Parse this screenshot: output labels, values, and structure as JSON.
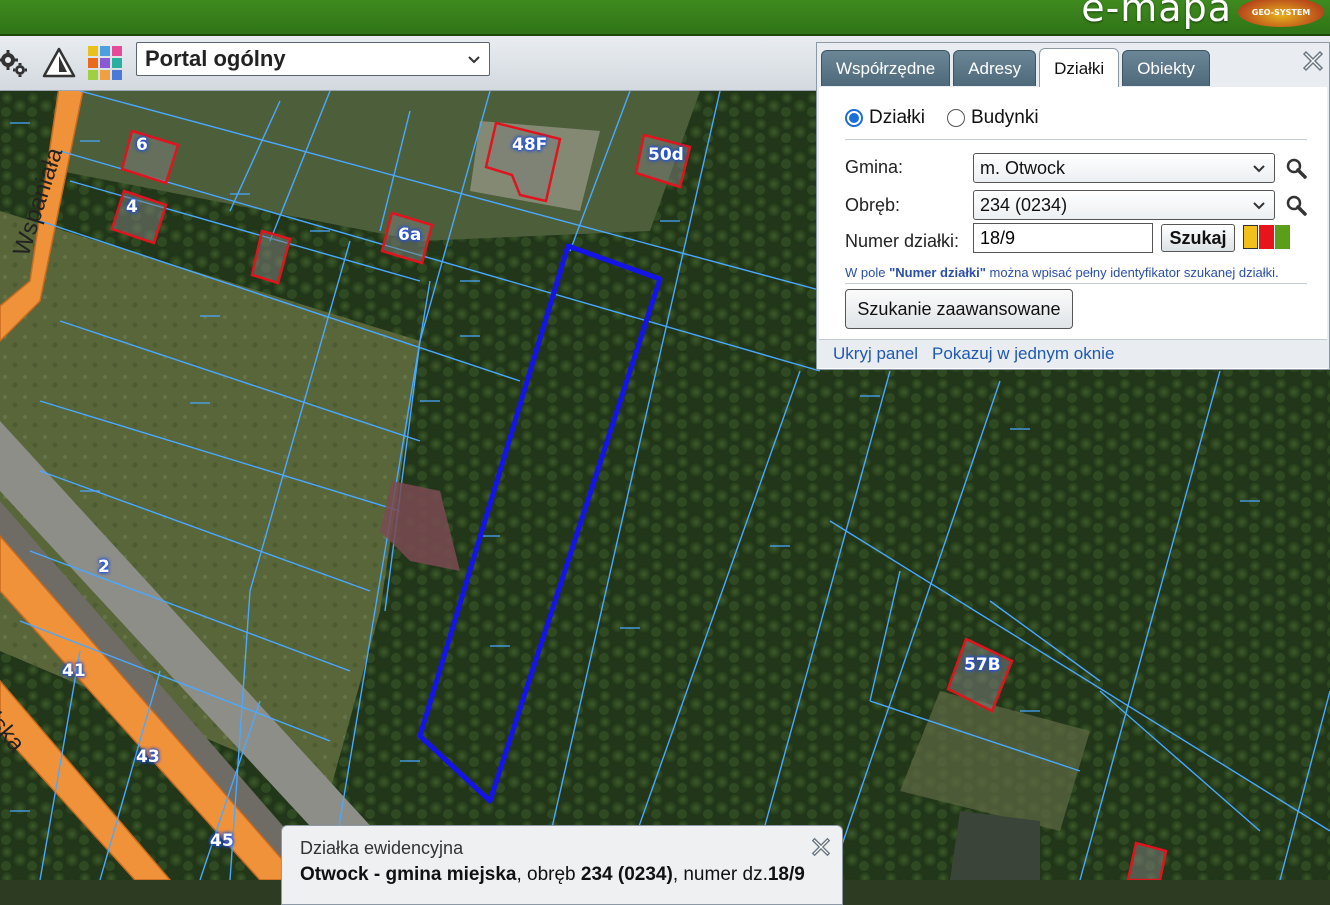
{
  "app": {
    "logo_text": "e-mapa",
    "logo_badge": "GEO-SYSTEM"
  },
  "toolbar": {
    "portal_select_value": "Portal ogólny",
    "icons": [
      "gears-icon",
      "warning-icon",
      "color-grid-icon"
    ]
  },
  "map": {
    "street_labels": [
      "Wspaniała",
      "elska"
    ],
    "address_labels": [
      "6",
      "4",
      "6a",
      "48F",
      "50d",
      "57B",
      "2",
      "41",
      "43",
      "45"
    ]
  },
  "panel": {
    "tabs": [
      {
        "label": "Współrzędne",
        "active": false
      },
      {
        "label": "Adresy",
        "active": false
      },
      {
        "label": "Działki",
        "active": true
      },
      {
        "label": "Obiekty",
        "active": false
      }
    ],
    "radio_dzialki": "Działki",
    "radio_budynki": "Budynki",
    "gmina_label": "Gmina:",
    "gmina_value": "m. Otwock",
    "obreb_label": "Obręb:",
    "obreb_value": "234 (0234)",
    "numer_label": "Numer działki:",
    "numer_value": "18/9",
    "search_button": "Szukaj",
    "color_boxes": [
      "#f2c01a",
      "#e8141b",
      "#5a9e1a"
    ],
    "hint_prefix": "W pole ",
    "hint_bold": "\"Numer działki\"",
    "hint_suffix": " można wpisać pełny identyfikator szukanej działki.",
    "advanced_button": "Szukanie zaawansowane",
    "footer_hide": "Ukryj panel",
    "footer_single": "Pokazuj w jednym oknie"
  },
  "info_box": {
    "title": "Działka ewidencyjna",
    "gmina": "Otwock - gmina miejska",
    "obreb_text": ", obręb ",
    "obreb": "234 (0234)",
    "numer_text": ", numer dz.",
    "numer": "18/9"
  },
  "colors": {
    "topbar": "#3f8a1f",
    "parcel_lines": "#4aa8ff",
    "selected_parcel": "#1414e6",
    "building_outline": "#e0141e",
    "road": "#f0923a"
  }
}
